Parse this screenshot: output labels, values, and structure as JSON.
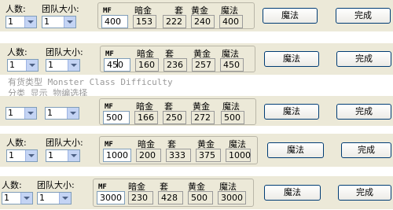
{
  "labels": {
    "people": "人数:",
    "team_size": "团队大小:"
  },
  "headers": {
    "mf": "MF",
    "dark_gold": "暗金",
    "set": "套",
    "yellow_gold": "黄金",
    "magic": "魔法"
  },
  "buttons": {
    "magic": "魔法",
    "done": "完成"
  },
  "rows": [
    {
      "people": "1",
      "team_size": "1",
      "mf": "400",
      "dark_gold": "153",
      "set": "222",
      "yellow_gold": "240",
      "magic": "400"
    },
    {
      "people": "1",
      "team_size": "1",
      "mf": "450",
      "dark_gold": "160",
      "set": "236",
      "yellow_gold": "257",
      "magic": "450"
    },
    {
      "people": "1",
      "team_size": "1",
      "mf": "500",
      "dark_gold": "166",
      "set": "250",
      "yellow_gold": "272",
      "magic": "500"
    },
    {
      "people": "1",
      "team_size": "1",
      "mf": "1000",
      "dark_gold": "200",
      "set": "333",
      "yellow_gold": "375",
      "magic": "1000"
    },
    {
      "people": "1",
      "team_size": "1",
      "mf": "3000",
      "dark_gold": "230",
      "set": "428",
      "yellow_gold": "500",
      "magic": "3000"
    }
  ],
  "fragments": [
    "有货类型     Monster Class  Difficulty",
    "分类  显示  物编选择"
  ]
}
